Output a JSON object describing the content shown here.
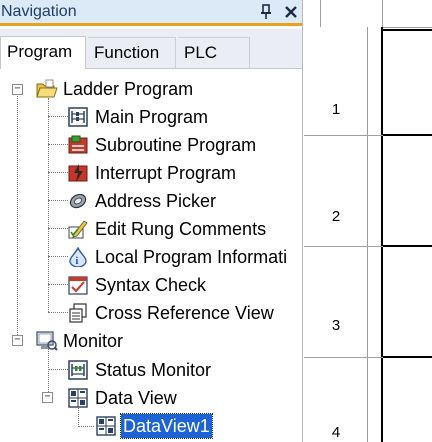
{
  "panel": {
    "title": "Navigation",
    "pin_glyph": "⬍",
    "close_glyph": "✕"
  },
  "tabs": [
    {
      "label": "Program",
      "active": true
    },
    {
      "label": "Function",
      "active": false
    },
    {
      "label": "PLC",
      "active": false
    }
  ],
  "tree": {
    "ladder_program": {
      "label": "Ladder Program",
      "expanded": true,
      "icon": "open-folder-icon",
      "children": [
        {
          "label": "Main Program",
          "icon": "main-program-icon"
        },
        {
          "label": "Subroutine Program",
          "icon": "subroutine-icon"
        },
        {
          "label": "Interrupt Program",
          "icon": "interrupt-icon"
        },
        {
          "label": "Address Picker",
          "icon": "address-picker-icon"
        },
        {
          "label": "Edit Rung Comments",
          "icon": "edit-comments-icon"
        },
        {
          "label": "Local Program Informati",
          "icon": "info-icon"
        },
        {
          "label": "Syntax Check",
          "icon": "syntax-check-icon"
        },
        {
          "label": "Cross Reference View",
          "icon": "cross-reference-icon"
        }
      ]
    },
    "monitor": {
      "label": "Monitor",
      "expanded": true,
      "icon": "monitor-icon",
      "children": [
        {
          "label": "Status Monitor",
          "icon": "status-monitor-icon"
        }
      ],
      "data_view": {
        "label": "Data View",
        "expanded": true,
        "icon": "data-view-icon",
        "children": [
          {
            "label": "DataView1",
            "icon": "data-view-item-icon",
            "selected": true
          }
        ]
      }
    }
  },
  "ladder": {
    "rung_numbers": [
      "1",
      "2",
      "3",
      "4"
    ]
  },
  "colors": {
    "title_bar": "#dce9f7",
    "title_accent": "#e8a020",
    "selection": "#1e63d6"
  }
}
